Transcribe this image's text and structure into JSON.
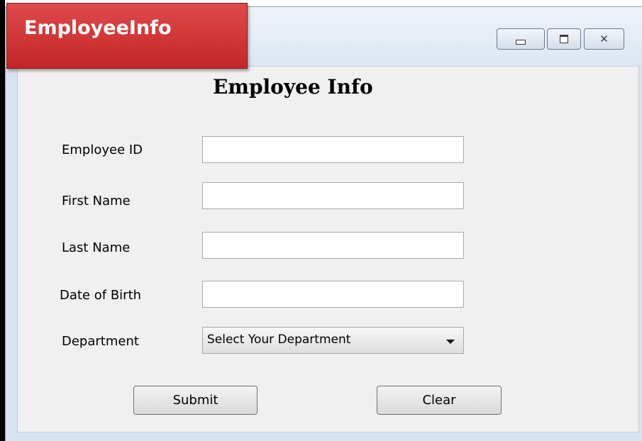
{
  "banner": {
    "label": "EmployeeInfo"
  },
  "window": {
    "controls": {
      "minimize_icon": "minimize-icon",
      "maximize_icon": "maximize-icon",
      "close_icon": "close-icon",
      "close_glyph": "✕"
    }
  },
  "form": {
    "title": "Employee Info",
    "fields": [
      {
        "label": "Employee ID",
        "value": ""
      },
      {
        "label": "First Name",
        "value": ""
      },
      {
        "label": "Last Name",
        "value": ""
      },
      {
        "label": "Date of Birth",
        "value": ""
      }
    ],
    "department": {
      "label": "Department",
      "selected": "Select Your Department"
    },
    "buttons": {
      "submit": "Submit",
      "clear": "Clear"
    }
  },
  "colors": {
    "banner_red": "#d43a3a",
    "window_frame": "#d7e3f1",
    "client_bg": "#f0f0f0"
  }
}
